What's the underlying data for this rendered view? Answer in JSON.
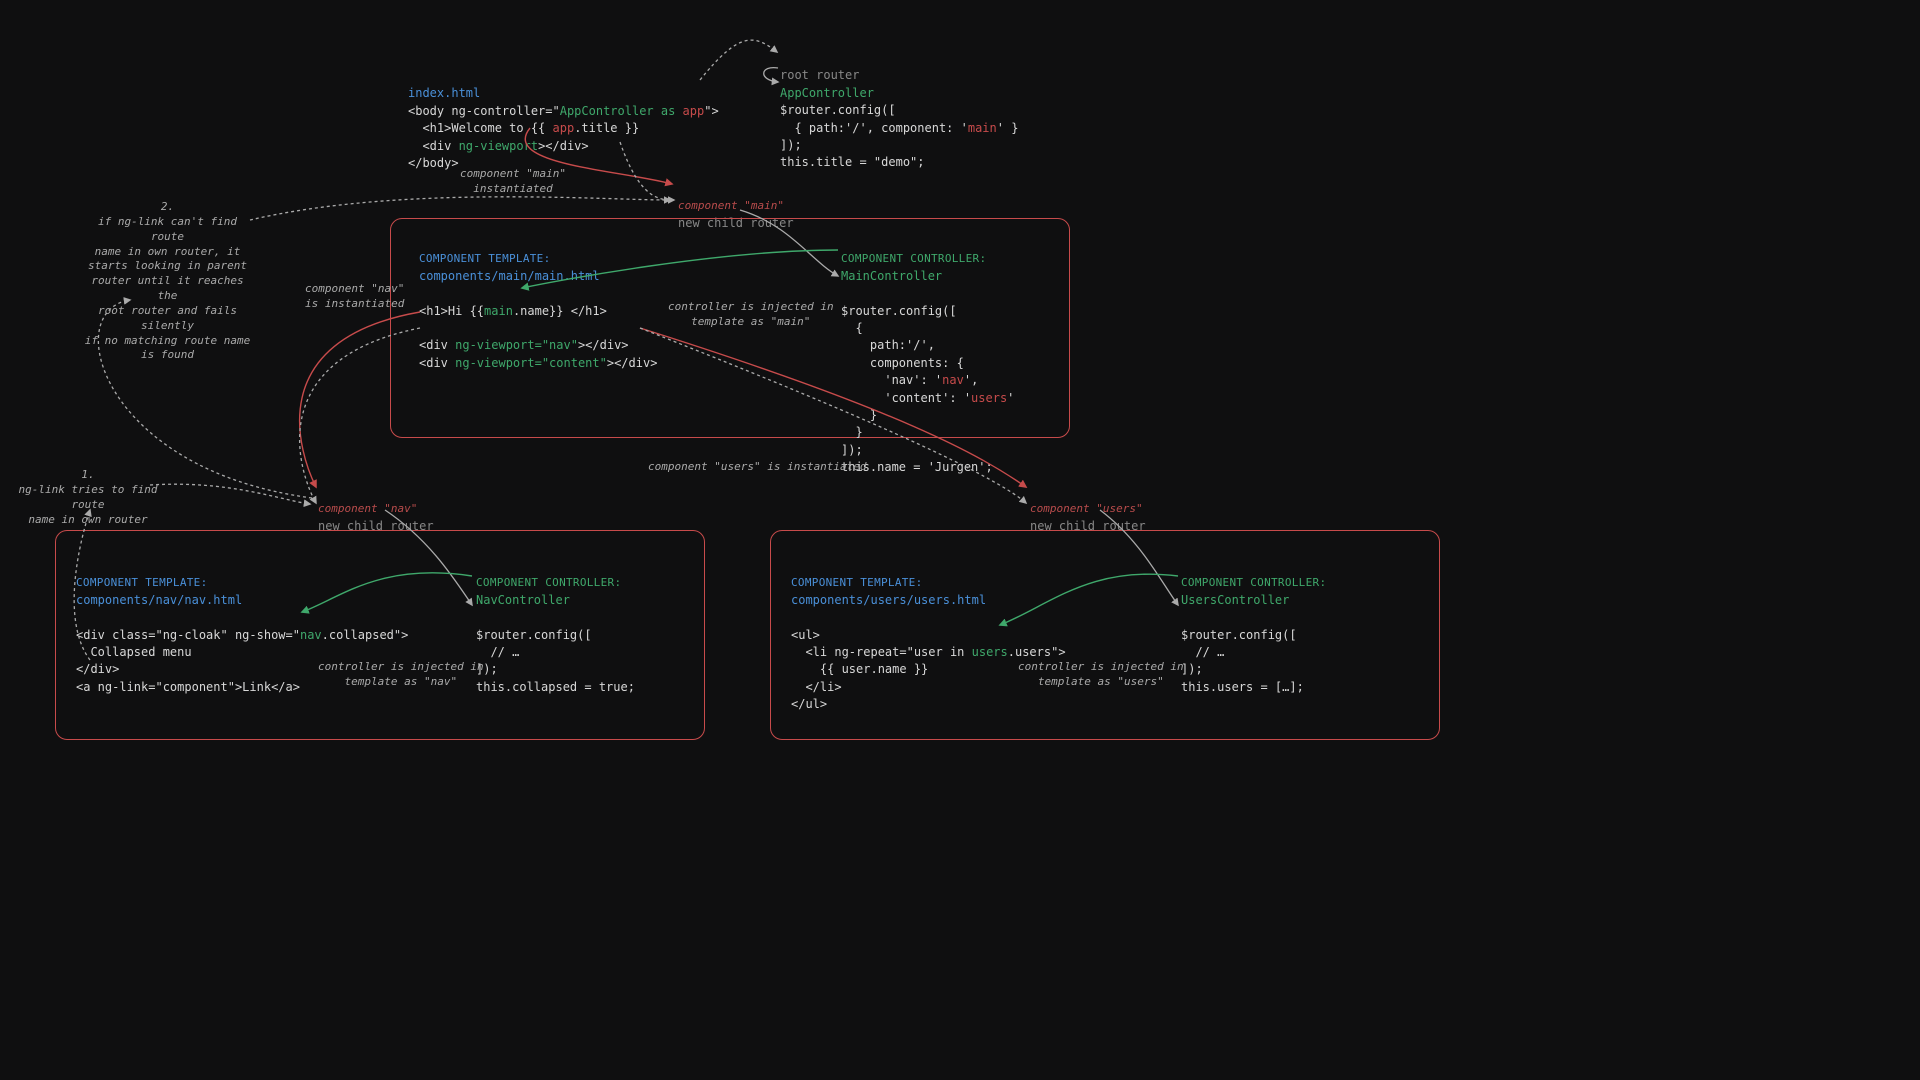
{
  "top": {
    "index_label": "index.html",
    "body_open": "<body ng-controller=\"",
    "app_ctrl": "AppController as ",
    "app_as": "app",
    "body_close": "\">",
    "h1a": "  <h1>Welcome to {{ ",
    "h1b": "app",
    "h1c": ".title }}",
    "div_a": "  <div ",
    "ngvp": "ng-viewport",
    "div_b": "></div>",
    "body_end": "</body>",
    "root_router": "root router",
    "app_controller": "AppController",
    "rc_line1": "$router.config([",
    "rc_line2a": "  { path:'/', component: '",
    "rc_line2b": "main",
    "rc_line2c": "' }",
    "rc_line3": "]);",
    "rc_line4": "this.title = \"demo\";"
  },
  "ann": {
    "main_inst": "component \"main\"\ninstantiated",
    "main_comp": "component \"main\"",
    "new_child": "new child router",
    "nav_inst": "component \"nav\"\nis instantiated",
    "users_inst": "component \"users\" is instantiated",
    "nav_comp": "component \"nav\"",
    "users_comp": "component \"users\"",
    "inj_main": "controller is injected in\ntemplate as \"main\"",
    "inj_nav": "controller is injected in\ntemplate as \"nav\"",
    "inj_users": "controller is injected in\ntemplate as \"users\"",
    "note1": "1.\nng-link tries to find route\nname in own router",
    "note2": "2.\nif ng-link can't find route\nname in own router, it\nstarts looking in parent\nrouter until it reaches the\nroot router and fails silently\nif no matching route name\nis found"
  },
  "main": {
    "tmpl_label": "COMPONENT TEMPLATE:",
    "tmpl_path": "components/main/main.html",
    "ctrl_label": "COMPONENT CONTROLLER:",
    "ctrl_name": "MainController",
    "h1a": "<h1>Hi {{",
    "h1b": "main",
    "h1c": ".name}} </h1>",
    "d1a": "<div ",
    "d1b": "ng-viewport=\"nav\"",
    "d1c": "></div>",
    "d2a": "<div ",
    "d2b": "ng-viewport=\"content\"",
    "d2c": "></div>",
    "rc1": "$router.config([",
    "rc2": "  {",
    "rc3": "    path:'/',",
    "rc4": "    components: {",
    "rc5a": "      'nav': '",
    "rc5b": "nav",
    "rc5c": "',",
    "rc6a": "      'content': '",
    "rc6b": "users",
    "rc6c": "'",
    "rc7": "    }",
    "rc8": "  }",
    "rc9": "]);",
    "rc10": "this.name = 'Jurgen';"
  },
  "nav": {
    "tmpl_label": "COMPONENT TEMPLATE:",
    "tmpl_path": "components/nav/nav.html",
    "ctrl_label": "COMPONENT CONTROLLER:",
    "ctrl_name": "NavController",
    "l1a": "<div class=\"ng-cloak\" ng-show=\"",
    "l1b": "nav",
    "l1c": ".collapsed\">",
    "l2": "  Collapsed menu",
    "l3": "</div>",
    "l4": "<a ng-link=\"component\">Link</a>",
    "rc1": "$router.config([",
    "rc2": "  // …",
    "rc3": "]);",
    "rc4": "this.collapsed = true;"
  },
  "users": {
    "tmpl_label": "COMPONENT TEMPLATE:",
    "tmpl_path": "components/users/users.html",
    "ctrl_label": "COMPONENT CONTROLLER:",
    "ctrl_name": "UsersController",
    "l1": "<ul>",
    "l2a": "  <li ng-repeat=\"user in ",
    "l2b": "users",
    "l2c": ".users\">",
    "l3": "    {{ user.name }}",
    "l4": "  </li>",
    "l5": "</ul>",
    "rc1": "$router.config([",
    "rc2": "  // …",
    "rc3": "]);",
    "rc4": "this.users = […];"
  }
}
